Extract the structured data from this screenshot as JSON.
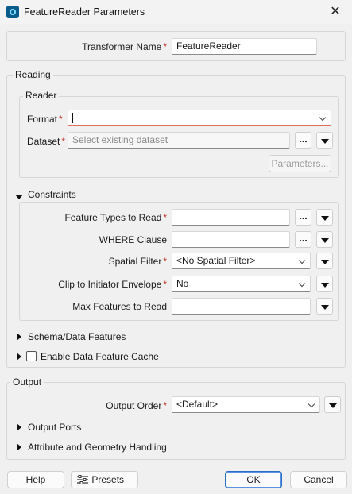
{
  "window": {
    "title": "FeatureReader Parameters",
    "close_glyph": "✕"
  },
  "transformer": {
    "label": "Transformer Name",
    "value": "FeatureReader"
  },
  "reading": {
    "title": "Reading",
    "reader": {
      "title": "Reader",
      "format": {
        "label": "Format",
        "value": ""
      },
      "dataset": {
        "label": "Dataset",
        "placeholder": "Select existing dataset",
        "browse": "..."
      },
      "parameters_button": "Parameters..."
    },
    "constraints": {
      "title": "Constraints",
      "feature_types": {
        "label": "Feature Types to Read",
        "value": "",
        "browse": "..."
      },
      "where": {
        "label": "WHERE Clause",
        "value": "",
        "browse": "..."
      },
      "spatial_filter": {
        "label": "Spatial Filter",
        "value": "<No Spatial Filter>"
      },
      "clip": {
        "label": "Clip to Initiator Envelope",
        "value": "No"
      },
      "max_features": {
        "label": "Max Features to Read",
        "value": ""
      }
    },
    "schema_section": "Schema/Data Features",
    "cache_section": "Enable Data Feature Cache"
  },
  "output": {
    "title": "Output",
    "order": {
      "label": "Output Order",
      "value": "<Default>"
    },
    "ports_section": "Output Ports",
    "attr_section": "Attribute and Geometry Handling"
  },
  "footer": {
    "help": "Help",
    "presets": "Presets",
    "ok": "OK",
    "cancel": "Cancel"
  },
  "required_marker": "*",
  "colors": {
    "required": "#c0392b",
    "error_border": "#e26a5e",
    "primary_border": "#2b6cc4"
  }
}
